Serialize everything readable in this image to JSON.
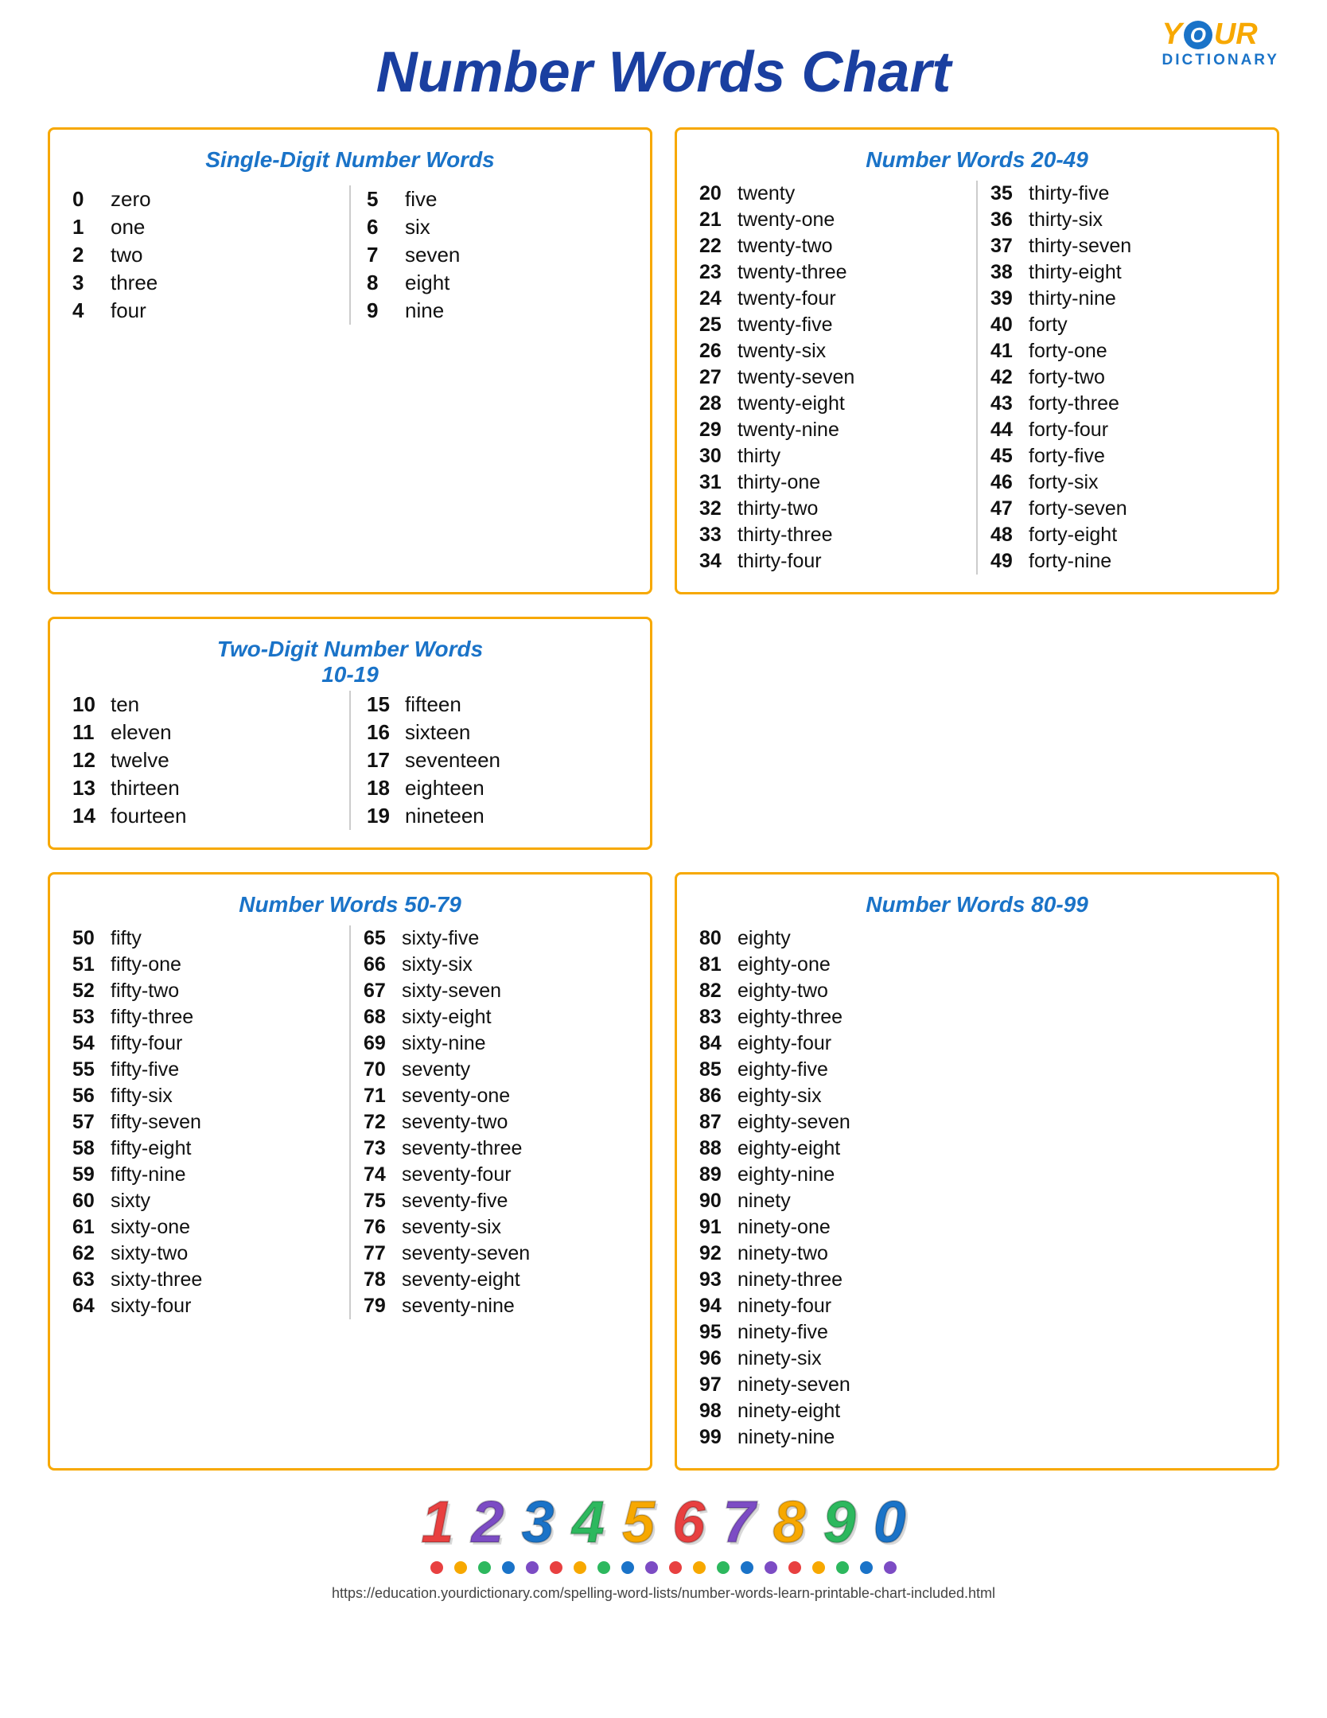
{
  "logo": {
    "your": "Y",
    "circle_letter": "O",
    "ur": "UR",
    "dictionary": "DICTIONARY"
  },
  "title": "Number Words Chart",
  "box1": {
    "title": "Single-Digit Number Words",
    "col1": [
      {
        "num": "0",
        "word": "zero"
      },
      {
        "num": "1",
        "word": "one"
      },
      {
        "num": "2",
        "word": "two"
      },
      {
        "num": "3",
        "word": "three"
      },
      {
        "num": "4",
        "word": "four"
      }
    ],
    "col2": [
      {
        "num": "5",
        "word": "five"
      },
      {
        "num": "6",
        "word": "six"
      },
      {
        "num": "7",
        "word": "seven"
      },
      {
        "num": "8",
        "word": "eight"
      },
      {
        "num": "9",
        "word": "nine"
      }
    ]
  },
  "box2": {
    "title": "Number Words 20-49",
    "col1": [
      {
        "num": "20",
        "word": "twenty"
      },
      {
        "num": "21",
        "word": "twenty-one"
      },
      {
        "num": "22",
        "word": "twenty-two"
      },
      {
        "num": "23",
        "word": "twenty-three"
      },
      {
        "num": "24",
        "word": "twenty-four"
      },
      {
        "num": "25",
        "word": "twenty-five"
      },
      {
        "num": "26",
        "word": "twenty-six"
      },
      {
        "num": "27",
        "word": "twenty-seven"
      },
      {
        "num": "28",
        "word": "twenty-eight"
      },
      {
        "num": "29",
        "word": "twenty-nine"
      },
      {
        "num": "30",
        "word": "thirty"
      },
      {
        "num": "31",
        "word": "thirty-one"
      },
      {
        "num": "32",
        "word": "thirty-two"
      },
      {
        "num": "33",
        "word": "thirty-three"
      },
      {
        "num": "34",
        "word": "thirty-four"
      }
    ],
    "col2": [
      {
        "num": "35",
        "word": "thirty-five"
      },
      {
        "num": "36",
        "word": "thirty-six"
      },
      {
        "num": "37",
        "word": "thirty-seven"
      },
      {
        "num": "38",
        "word": "thirty-eight"
      },
      {
        "num": "39",
        "word": "thirty-nine"
      },
      {
        "num": "40",
        "word": "forty"
      },
      {
        "num": "41",
        "word": "forty-one"
      },
      {
        "num": "42",
        "word": "forty-two"
      },
      {
        "num": "43",
        "word": "forty-three"
      },
      {
        "num": "44",
        "word": "forty-four"
      },
      {
        "num": "45",
        "word": "forty-five"
      },
      {
        "num": "46",
        "word": "forty-six"
      },
      {
        "num": "47",
        "word": "forty-seven"
      },
      {
        "num": "48",
        "word": "forty-eight"
      },
      {
        "num": "49",
        "word": "forty-nine"
      }
    ]
  },
  "box3": {
    "title1": "Two-Digit Number Words",
    "title2": "10-19",
    "col1": [
      {
        "num": "10",
        "word": "ten"
      },
      {
        "num": "11",
        "word": "eleven"
      },
      {
        "num": "12",
        "word": "twelve"
      },
      {
        "num": "13",
        "word": "thirteen"
      },
      {
        "num": "14",
        "word": "fourteen"
      }
    ],
    "col2": [
      {
        "num": "15",
        "word": "fifteen"
      },
      {
        "num": "16",
        "word": "sixteen"
      },
      {
        "num": "17",
        "word": "seventeen"
      },
      {
        "num": "18",
        "word": "eighteen"
      },
      {
        "num": "19",
        "word": "nineteen"
      }
    ]
  },
  "box4": {
    "title": "Number Words 50-79",
    "col1": [
      {
        "num": "50",
        "word": "fifty"
      },
      {
        "num": "51",
        "word": "fifty-one"
      },
      {
        "num": "52",
        "word": "fifty-two"
      },
      {
        "num": "53",
        "word": "fifty-three"
      },
      {
        "num": "54",
        "word": "fifty-four"
      },
      {
        "num": "55",
        "word": "fifty-five"
      },
      {
        "num": "56",
        "word": "fifty-six"
      },
      {
        "num": "57",
        "word": "fifty-seven"
      },
      {
        "num": "58",
        "word": "fifty-eight"
      },
      {
        "num": "59",
        "word": "fifty-nine"
      },
      {
        "num": "60",
        "word": "sixty"
      },
      {
        "num": "61",
        "word": "sixty-one"
      },
      {
        "num": "62",
        "word": "sixty-two"
      },
      {
        "num": "63",
        "word": "sixty-three"
      },
      {
        "num": "64",
        "word": "sixty-four"
      }
    ],
    "col2": [
      {
        "num": "65",
        "word": "sixty-five"
      },
      {
        "num": "66",
        "word": "sixty-six"
      },
      {
        "num": "67",
        "word": "sixty-seven"
      },
      {
        "num": "68",
        "word": "sixty-eight"
      },
      {
        "num": "69",
        "word": "sixty-nine"
      },
      {
        "num": "70",
        "word": "seventy"
      },
      {
        "num": "71",
        "word": "seventy-one"
      },
      {
        "num": "72",
        "word": "seventy-two"
      },
      {
        "num": "73",
        "word": "seventy-three"
      },
      {
        "num": "74",
        "word": "seventy-four"
      },
      {
        "num": "75",
        "word": "seventy-five"
      },
      {
        "num": "76",
        "word": "seventy-six"
      },
      {
        "num": "77",
        "word": "seventy-seven"
      },
      {
        "num": "78",
        "word": "seventy-eight"
      },
      {
        "num": "79",
        "word": "seventy-nine"
      }
    ]
  },
  "box5": {
    "title": "Number Words 80-99",
    "col1": [
      {
        "num": "80",
        "word": "eighty"
      },
      {
        "num": "81",
        "word": "eighty-one"
      },
      {
        "num": "82",
        "word": "eighty-two"
      },
      {
        "num": "83",
        "word": "eighty-three"
      },
      {
        "num": "84",
        "word": "eighty-four"
      },
      {
        "num": "85",
        "word": "eighty-five"
      },
      {
        "num": "86",
        "word": "eighty-six"
      },
      {
        "num": "87",
        "word": "eighty-seven"
      },
      {
        "num": "88",
        "word": "eighty-eight"
      },
      {
        "num": "89",
        "word": "eighty-nine"
      },
      {
        "num": "90",
        "word": "ninety"
      },
      {
        "num": "91",
        "word": "ninety-one"
      },
      {
        "num": "92",
        "word": "ninety-two"
      },
      {
        "num": "93",
        "word": "ninety-three"
      },
      {
        "num": "94",
        "word": "ninety-four"
      },
      {
        "num": "95",
        "word": "ninety-five"
      },
      {
        "num": "96",
        "word": "ninety-six"
      },
      {
        "num": "97",
        "word": "ninety-seven"
      },
      {
        "num": "98",
        "word": "ninety-eight"
      },
      {
        "num": "99",
        "word": "ninety-nine"
      }
    ]
  },
  "deco": {
    "numbers": [
      {
        "char": "1",
        "color": "#e84040"
      },
      {
        "char": "2",
        "color": "#7c4cc4"
      },
      {
        "char": "3",
        "color": "#1a73c8"
      },
      {
        "char": "4",
        "color": "#2db85e"
      },
      {
        "char": "5",
        "color": "#f7a800"
      },
      {
        "char": "6",
        "color": "#e84040"
      },
      {
        "char": "7",
        "color": "#7c4cc4"
      },
      {
        "char": "8",
        "color": "#f7a800"
      },
      {
        "char": "9",
        "color": "#2db85e"
      },
      {
        "char": "0",
        "color": "#1a73c8"
      }
    ],
    "dots": [
      "#e84040",
      "#f7a800",
      "#2db85e",
      "#1a73c8",
      "#7c4cc4",
      "#e84040",
      "#f7a800",
      "#2db85e",
      "#1a73c8",
      "#7c4cc4",
      "#e84040",
      "#f7a800",
      "#2db85e",
      "#1a73c8",
      "#7c4cc4",
      "#e84040",
      "#f7a800",
      "#2db85e",
      "#1a73c8",
      "#7c4cc4"
    ]
  },
  "footer_url": "https://education.yourdictionary.com/spelling-word-lists/number-words-learn-printable-chart-included.html"
}
